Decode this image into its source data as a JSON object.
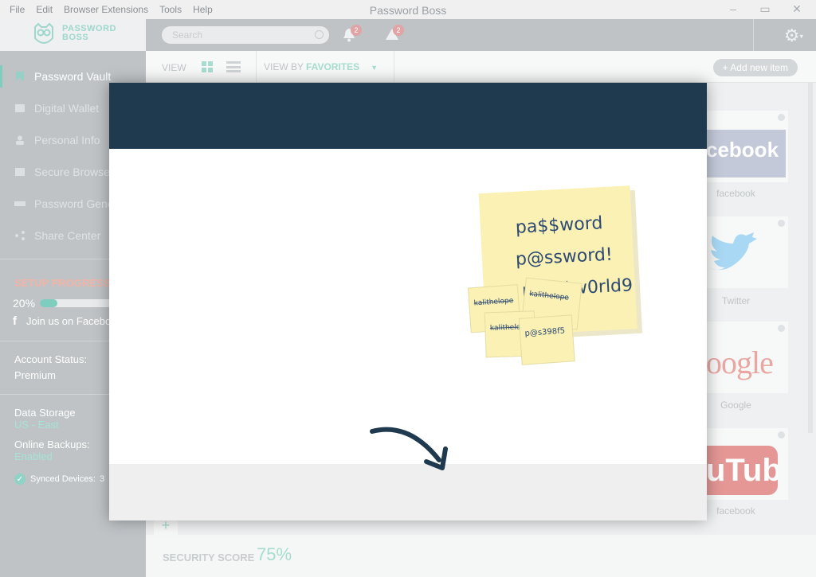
{
  "menu": [
    "File",
    "Edit",
    "Browser Extensions",
    "Tools",
    "Help"
  ],
  "window_title": "Password Boss",
  "logo": {
    "line1": "PASSWORD",
    "line2": "BOSS"
  },
  "search": {
    "placeholder": "Search"
  },
  "notifications": {
    "bell_count": "2",
    "alert_count": "2"
  },
  "sidebar": {
    "items": [
      {
        "label": "Password Vault",
        "icon": "bookmark-icon"
      },
      {
        "label": "Digital Wallet",
        "icon": "wallet-icon"
      },
      {
        "label": "Personal Info",
        "icon": "person-icon"
      },
      {
        "label": "Secure Browser",
        "icon": "browser-icon"
      },
      {
        "label": "Password Generator",
        "icon": "generator-icon"
      },
      {
        "label": "Share Center",
        "icon": "share-icon"
      }
    ],
    "setup_title": "SETUP PROGRESS",
    "setup_percent": "20%",
    "setup_fraction": 0.2,
    "join_text": "Join us on Facebook",
    "account_status_label": "Account Status:",
    "account_status_value": "Premium",
    "data_storage_label": "Data Storage",
    "data_storage_value": "US - East",
    "online_backups_label": "Online Backups:",
    "online_backups_value": "Enabled",
    "synced_label": "Synced Devices:",
    "synced_count": "3"
  },
  "toolbar": {
    "view_label": "VIEW",
    "view_by_label": "VIEW BY",
    "view_by_value": "FAVORITES",
    "add_button": "+ Add new item"
  },
  "tiles": [
    {
      "name": "facebook",
      "caption": "facebook",
      "logo_text": "cebook"
    },
    {
      "name": "twitter",
      "caption": "Twitter"
    },
    {
      "name": "google",
      "caption": "Google",
      "logo_text": "oogle"
    },
    {
      "name": "youtube",
      "caption": "facebook",
      "logo_text": "uTube"
    }
  ],
  "security": {
    "label": "SECURITY SCORE",
    "value": "75%"
  },
  "sticky_notes": {
    "main_lines": [
      "pa$$word",
      "p@ssword!",
      "p@$$w0rld9"
    ],
    "small_notes": [
      "kalithelope",
      "kalithelope",
      "kalithelope",
      "p@s398f5"
    ]
  },
  "colors": {
    "accent": "#7fcdbf",
    "modal_header": "#1f3a4f",
    "badge": "#e2a3a5"
  }
}
